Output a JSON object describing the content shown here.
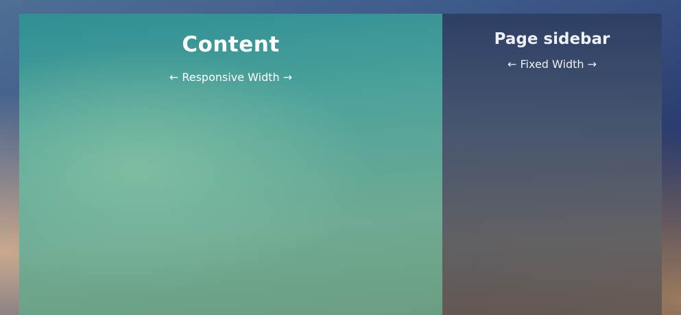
{
  "content": {
    "title": "Content",
    "subtitle": "← Responsive Width →"
  },
  "sidebar": {
    "title": "Page sidebar",
    "subtitle": "← Fixed Width →"
  },
  "colors": {
    "content_bg": "#5aa59a",
    "sidebar_bg": "#4e5a72",
    "page_bg": "#3e5b8a",
    "text": "#ffffff"
  }
}
